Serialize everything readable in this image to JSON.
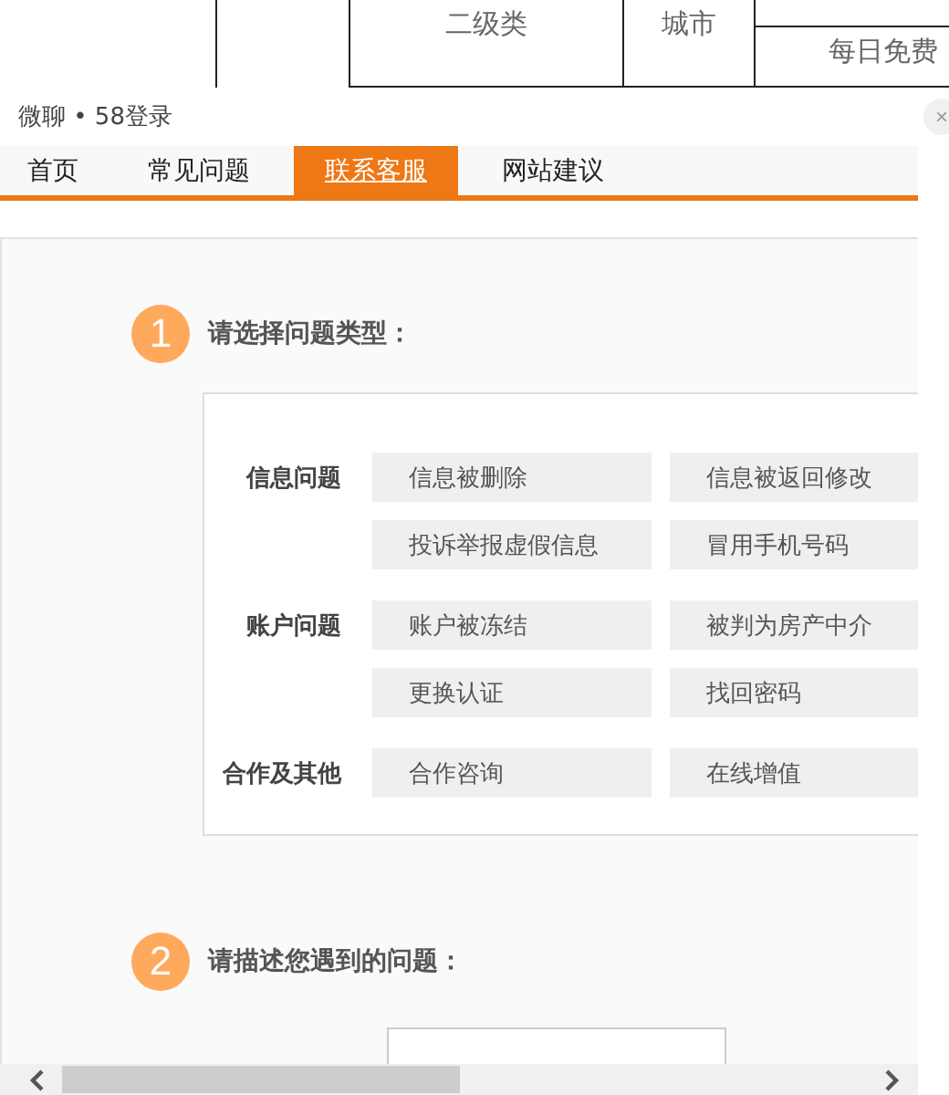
{
  "background_table": {
    "cells": [
      "二级类",
      "城市",
      "每日免费"
    ]
  },
  "dialog": {
    "title": "微聊 • 58登录",
    "close": "×",
    "tabs": [
      {
        "label": "首页",
        "selected": false
      },
      {
        "label": "常见问题",
        "selected": false
      },
      {
        "label": "联系客服",
        "selected": true
      },
      {
        "label": "网站建议",
        "selected": false
      }
    ],
    "steps": [
      {
        "number": "1",
        "title": "请选择问题类型：",
        "kind": "choices",
        "groups": [
          {
            "label": "信息问题",
            "options": [
              "信息被删除",
              "信息被返回修改",
              "投诉举报虚假信息",
              "冒用手机号码"
            ]
          },
          {
            "label": "账户问题",
            "options": [
              "账户被冻结",
              "被判为房产中介",
              "更换认证",
              "找回密码"
            ]
          },
          {
            "label": "合作及其他",
            "options": [
              "合作咨询",
              "在线增值"
            ]
          }
        ]
      },
      {
        "number": "2",
        "title": "请描述您遇到的问题：",
        "kind": "text"
      }
    ]
  }
}
